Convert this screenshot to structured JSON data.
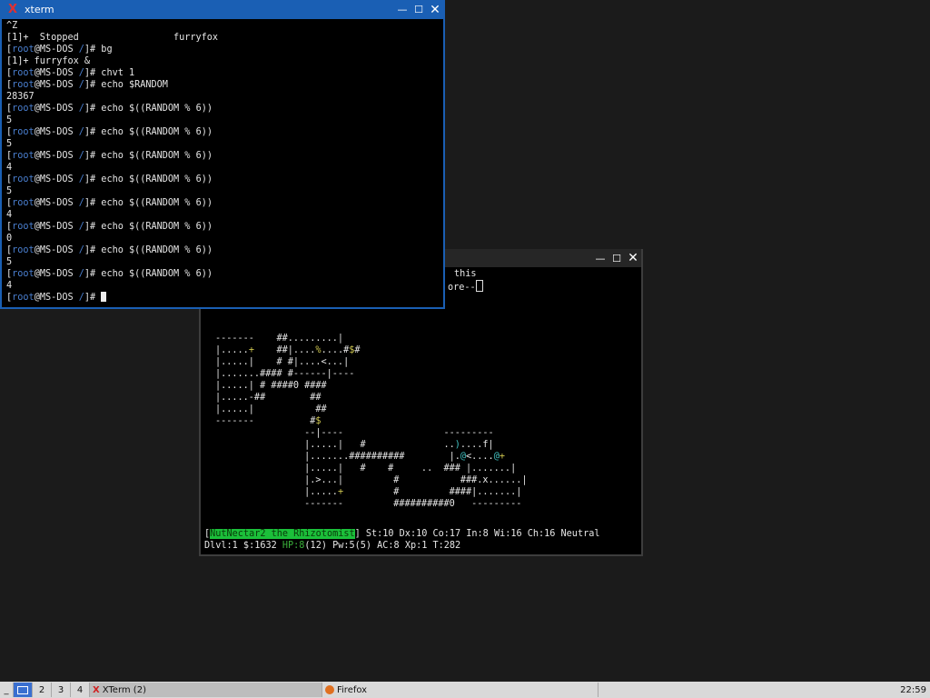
{
  "colors": {
    "accent": "#1a5fb4",
    "prompt_user": "#4a7fd0",
    "status_highlight": "#1bbf3a"
  },
  "xterm": {
    "title": "xterm",
    "lines": [
      "^Z",
      "[1]+  Stopped                 furryfox",
      "[root@MS-DOS /]# bg",
      "[1]+ furryfox &",
      "[root@MS-DOS /]# chvt 1",
      "[root@MS-DOS /]# echo $RANDOM",
      "28367",
      "[root@MS-DOS /]# echo $((RANDOM % 6))",
      "5",
      "[root@MS-DOS /]# echo $((RANDOM % 6))",
      "5",
      "[root@MS-DOS /]# echo $((RANDOM % 6))",
      "4",
      "[root@MS-DOS /]# echo $((RANDOM % 6))",
      "5",
      "[root@MS-DOS /]# echo $((RANDOM % 6))",
      "4",
      "[root@MS-DOS /]# echo $((RANDOM % 6))",
      "0",
      "[root@MS-DOS /]# echo $((RANDOM % 6))",
      "5",
      "[root@MS-DOS /]# echo $((RANDOM % 6))",
      "4",
      "[root@MS-DOS /]# "
    ]
  },
  "game": {
    "message_line1": "this",
    "message_line2": "ore--",
    "map": [
      "-------    ##.........|",
      "|.....+    ##|....%....#$#",
      "|.....|    # #|....<...|",
      "|.......#### #------|----",
      "|.....| # ####0 ####",
      "|.....-##        ##",
      "|.....|           ##",
      "-------          #$",
      "                --|----                  ---------",
      "                |.....|   #              ..)....f|",
      "                |.......##########        |.@<....@+",
      "                |.....|   #    #     ..  ### |.......|",
      "                |.>...|         #           ###.x......|",
      "                |.....+         #         ####|.......|",
      "                -------         ##########0   ---------"
    ],
    "status_name": "NutNectar2 the Rhizotomist",
    "status_stats": "] St:10 Dx:10 Co:17 In:8 Wi:16 Ch:16 Neutral",
    "status2_prefix": "Dlvl:1 $:1632 ",
    "status2_hp": "HP:8",
    "status2_rest": "(12) Pw:5(5) AC:8 Xp:1 T:282"
  },
  "taskbar": {
    "workspaces": [
      "1",
      "2",
      "3",
      "4"
    ],
    "tasks": [
      "XTerm (2)",
      "Firefox"
    ],
    "clock": "22:59"
  }
}
